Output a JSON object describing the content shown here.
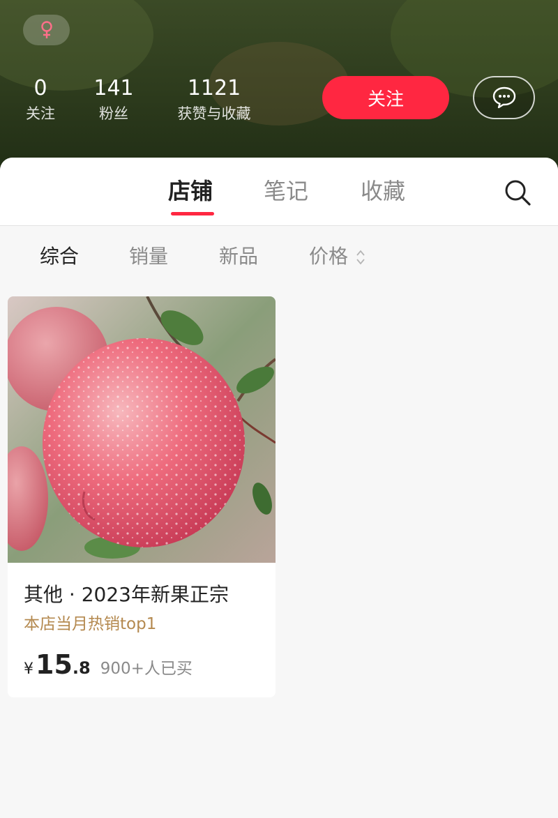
{
  "profile": {
    "gender_icon": "female-icon",
    "stats": [
      {
        "value": "0",
        "label": "关注"
      },
      {
        "value": "141",
        "label": "粉丝"
      },
      {
        "value": "1121",
        "label": "获赞与收藏"
      }
    ],
    "follow_label": "关注",
    "message_icon": "chat-bubble-icon"
  },
  "tabs": {
    "items": [
      "店铺",
      "笔记",
      "收藏"
    ],
    "active": "店铺",
    "search_icon": "search-icon"
  },
  "filters": {
    "items": [
      "综合",
      "销量",
      "新品",
      "价格"
    ],
    "active": "综合",
    "sort_icon": "sort-updown-icon"
  },
  "product": {
    "title": "其他 · 2023年新果正宗",
    "tag": "本店当月热销top1",
    "currency": "¥",
    "price_int": "15",
    "price_dec": ".8",
    "sold": "900+人已买"
  },
  "colors": {
    "accent": "#ff2741",
    "tag": "#b4894f",
    "header_bg": "#2c3a1c"
  }
}
